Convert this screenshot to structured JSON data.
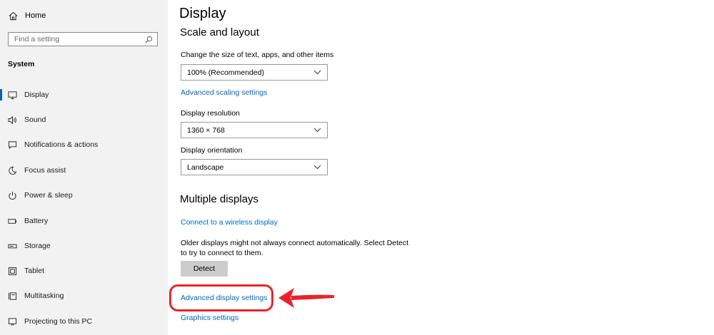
{
  "sidebar": {
    "home_label": "Home",
    "search_placeholder": "Find a setting",
    "section_title": "System",
    "items": [
      {
        "label": "Display",
        "icon": "monitor-icon",
        "active": true
      },
      {
        "label": "Sound",
        "icon": "speaker-icon"
      },
      {
        "label": "Notifications & actions",
        "icon": "notification-icon"
      },
      {
        "label": "Focus assist",
        "icon": "moon-icon"
      },
      {
        "label": "Power & sleep",
        "icon": "power-icon"
      },
      {
        "label": "Battery",
        "icon": "battery-icon"
      },
      {
        "label": "Storage",
        "icon": "storage-icon"
      },
      {
        "label": "Tablet",
        "icon": "tablet-icon"
      },
      {
        "label": "Multitasking",
        "icon": "multitasking-icon"
      },
      {
        "label": "Projecting to this PC",
        "icon": "projector-icon"
      }
    ]
  },
  "main": {
    "title": "Display",
    "scale_heading": "Scale and layout",
    "scale_label": "Change the size of text, apps, and other items",
    "scale_value": "100% (Recommended)",
    "advanced_scaling_link": "Advanced scaling settings",
    "resolution_label": "Display resolution",
    "resolution_value": "1360 × 768",
    "orientation_label": "Display orientation",
    "orientation_value": "Landscape",
    "multiple_heading": "Multiple displays",
    "wireless_link": "Connect to a wireless display",
    "detect_description": "Older displays might not always connect automatically. Select Detect to try to connect to them.",
    "detect_button": "Detect",
    "advanced_display_link": "Advanced display settings",
    "graphics_link": "Graphics settings"
  },
  "colors": {
    "accent": "#0063b1",
    "link": "#0067c0",
    "highlight": "#e8242a",
    "sidebar_bg": "#f2f2f2"
  }
}
